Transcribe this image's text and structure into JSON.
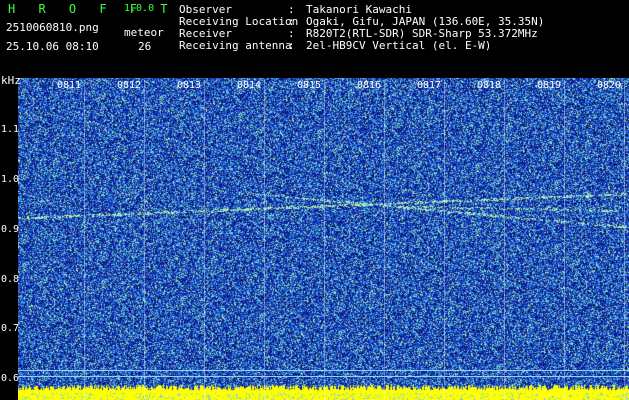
{
  "header": {
    "app_title": "H R O F F T",
    "app_version": "1.0.0",
    "filename": "2510060810.png",
    "timestamp": "25.10.06 08:10",
    "meteor_label": "meteor",
    "meteor_count": "26"
  },
  "info": [
    {
      "key": "Observer",
      "colon": ":",
      "value": "Takanori Kawachi"
    },
    {
      "key": "Receiving Location",
      "colon": ":",
      "value": "Ogaki, Gifu, JAPAN (136.60E, 35.35N)"
    },
    {
      "key": "Receiver",
      "colon": ":",
      "value": "R820T2(RTL-SDR) SDR-Sharp 53.372MHz"
    },
    {
      "key": "Receiving antenna",
      "colon": ":",
      "value": "2el-HB9CV Vertical (el. E-W)"
    }
  ],
  "axis": {
    "unit": "kHz",
    "y_ticks": [
      "1.1",
      "1.0",
      "0.9",
      "0.8",
      "0.7",
      "0.6"
    ],
    "x_ticks": [
      "0811",
      "0812",
      "0813",
      "0814",
      "0815",
      "0816",
      "0817",
      "0818",
      "0819",
      "0820"
    ]
  },
  "colors": {
    "text_green": "#3cff3c",
    "spectrogram_base": "#1a2fb0",
    "noise_level": "#ffff00"
  }
}
